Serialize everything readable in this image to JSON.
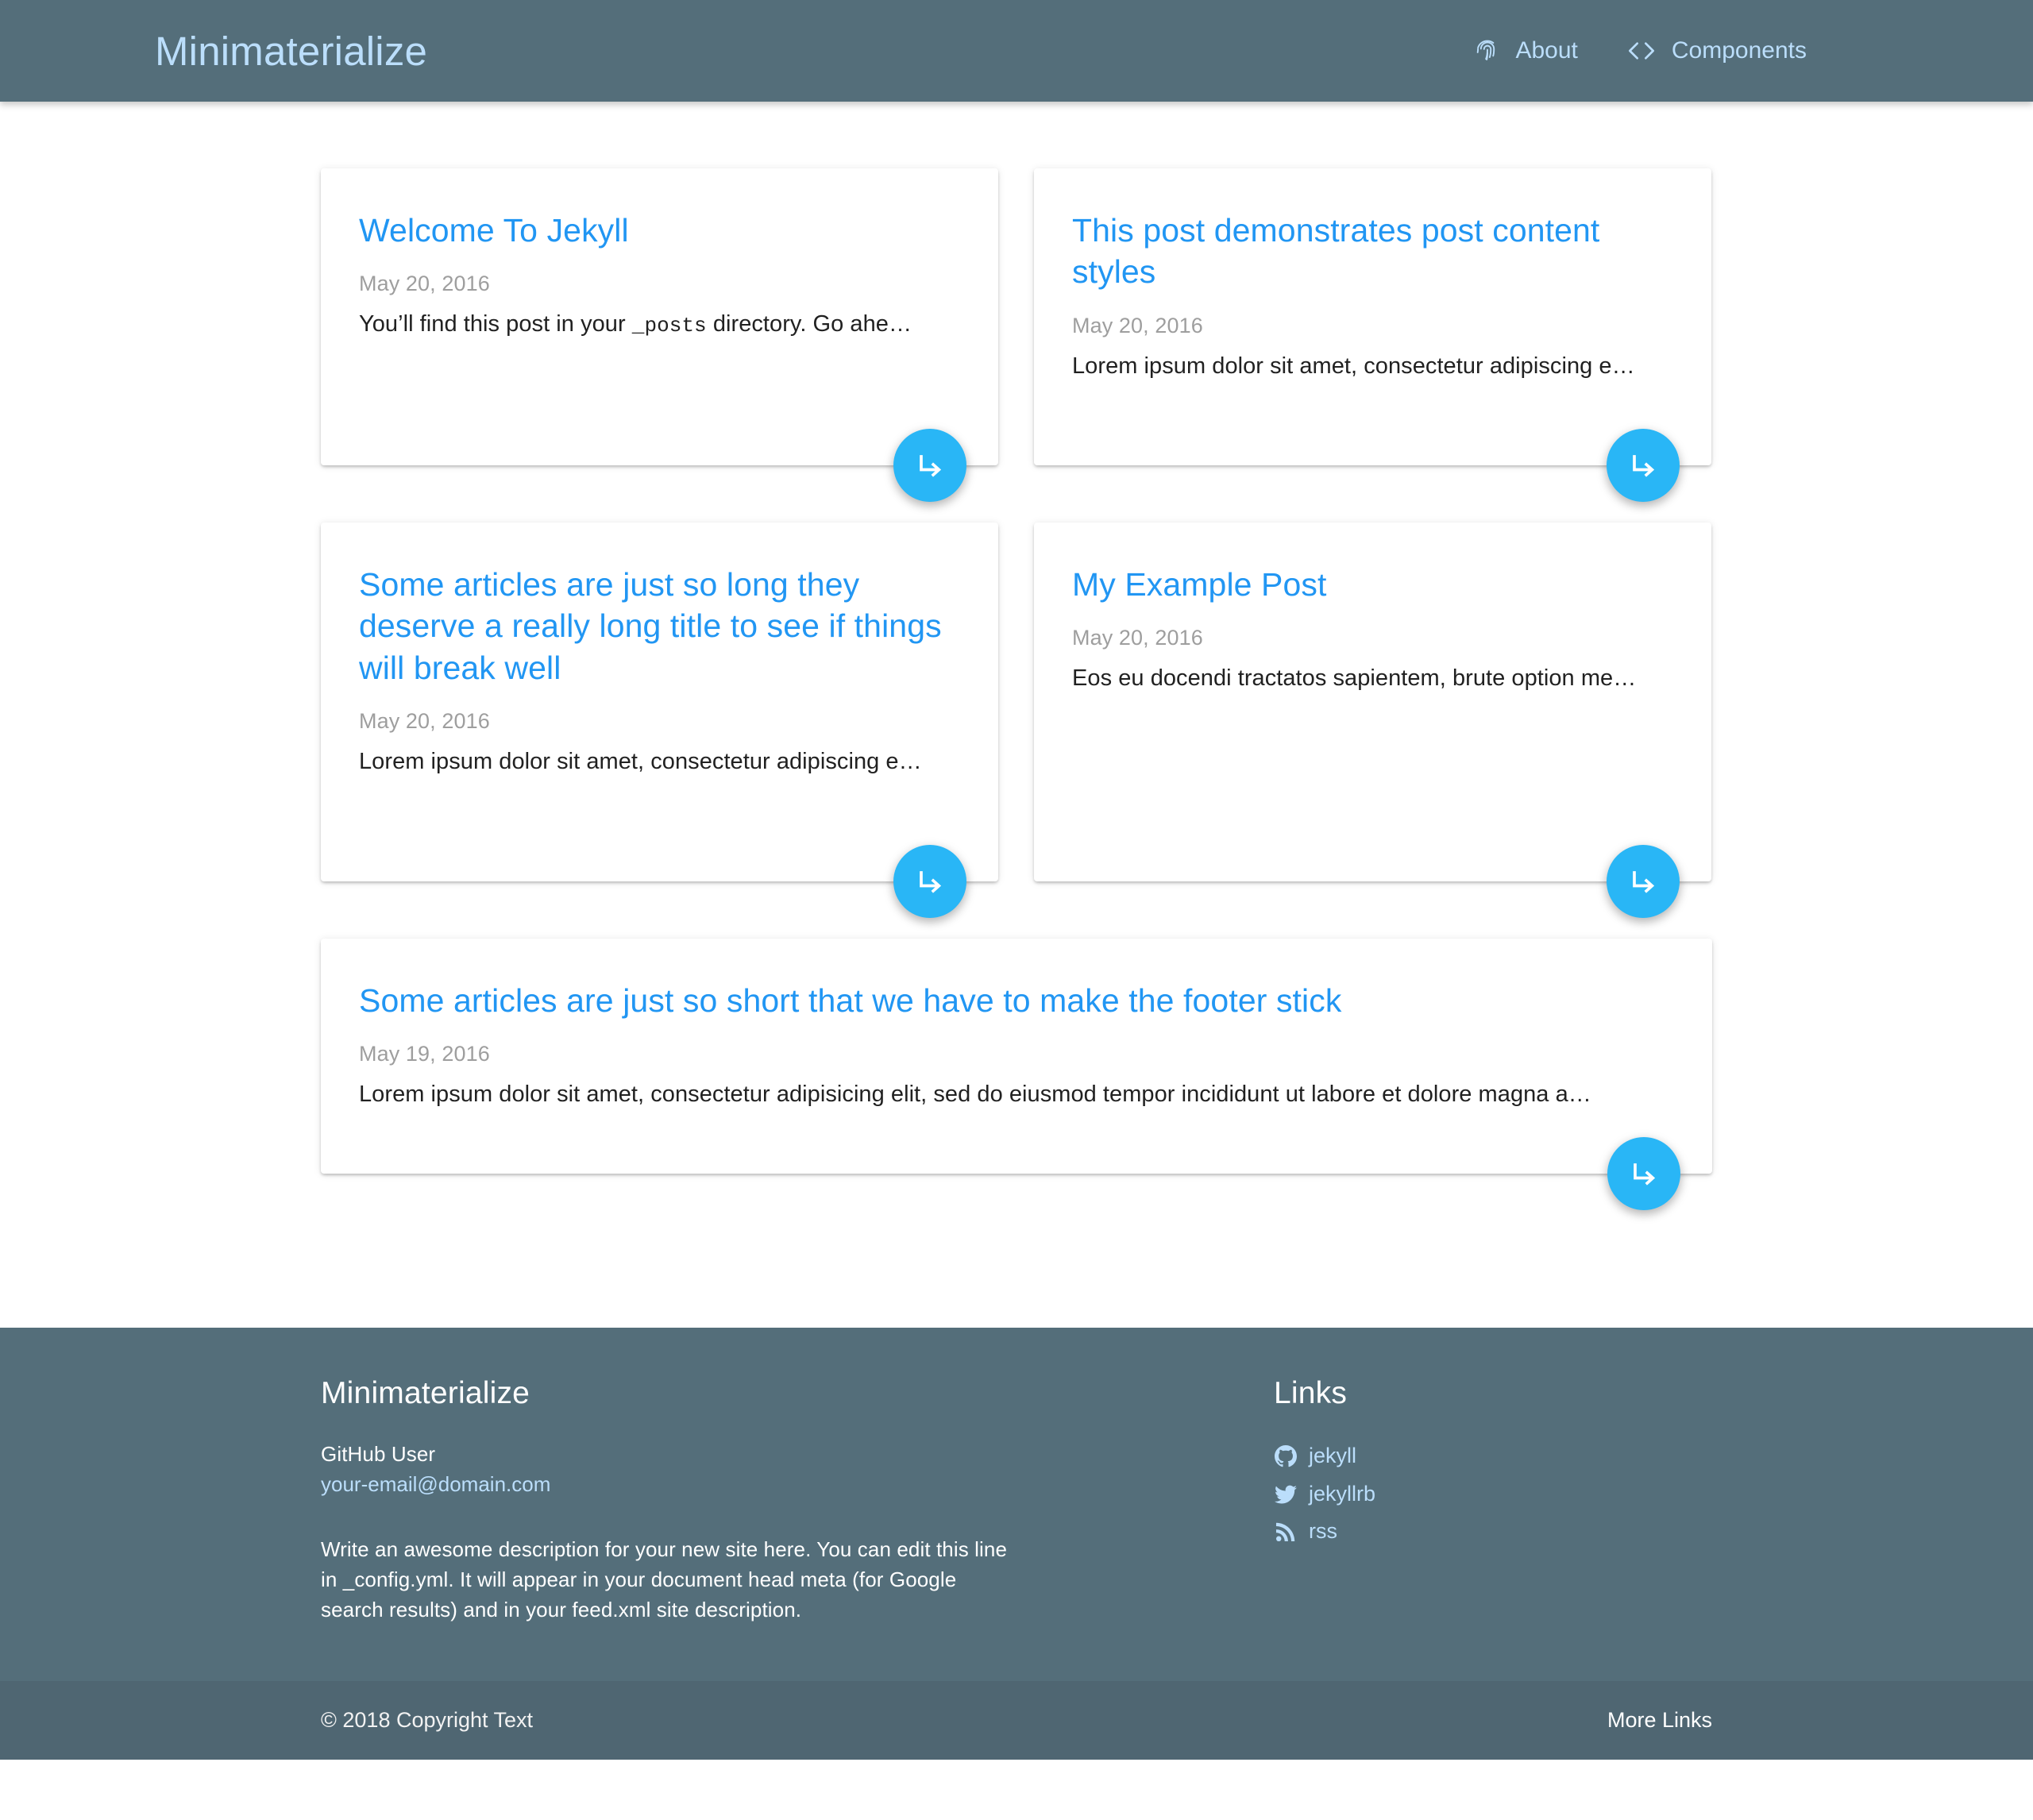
{
  "navbar": {
    "brand": "Minimaterialize",
    "links": [
      {
        "label": "About",
        "icon": "fingerprint-icon"
      },
      {
        "label": "Components",
        "icon": "code-brackets-icon"
      }
    ]
  },
  "posts": [
    {
      "title": "Welcome To Jekyll",
      "date": "May 20, 2016",
      "excerpt_pre": "You’ll find this post in your ",
      "excerpt_code": "_posts",
      "excerpt_post": " directory. Go ahe…",
      "read_more_icon": "subdirectory-arrow-right-icon"
    },
    {
      "title": "This post demonstrates post content styles",
      "date": "May 20, 2016",
      "excerpt": "Lorem ipsum dolor sit amet, consectetur adipiscing e…",
      "read_more_icon": "subdirectory-arrow-right-icon"
    },
    {
      "title": "Some articles are just so long they deserve a really long title to see if things will break well",
      "date": "May 20, 2016",
      "excerpt": "Lorem ipsum dolor sit amet, consectetur adipiscing e…",
      "read_more_icon": "subdirectory-arrow-right-icon"
    },
    {
      "title": "My Example Post",
      "date": "May 20, 2016",
      "excerpt": "Eos eu docendi tractatos sapientem, brute option me…",
      "read_more_icon": "subdirectory-arrow-right-icon"
    },
    {
      "title": "Some articles are just so short that we have to make the footer stick",
      "date": "May 19, 2016",
      "excerpt": "Lorem ipsum dolor sit amet, consectetur adipisicing elit, sed do eiusmod tempor incididunt ut labore et dolore magna a…",
      "read_more_icon": "subdirectory-arrow-right-icon"
    }
  ],
  "footer": {
    "title": "Minimaterialize",
    "github_user": "GitHub User",
    "email": "your-email@domain.com",
    "description": "Write an awesome description for your new site here. You can edit this line in _config.yml. It will appear in your document head meta (for Google search results) and in your feed.xml site description.",
    "links_title": "Links",
    "links": [
      {
        "label": "jekyll",
        "icon": "github-icon"
      },
      {
        "label": "jekyllrb",
        "icon": "twitter-icon"
      },
      {
        "label": "rss",
        "icon": "rss-icon"
      }
    ],
    "copyright": "© 2018 Copyright Text",
    "more_links": "More Links"
  },
  "colors": {
    "primary": "#546E7A",
    "primary_dark": "#4F6672",
    "accent": "#2196F3",
    "fab": "#29B6F6",
    "link_light": "#BBDEFB"
  }
}
